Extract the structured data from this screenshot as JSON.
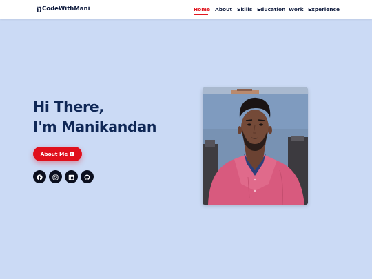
{
  "brand": {
    "name": "CodeWithMani"
  },
  "nav": {
    "items": [
      {
        "label": "Home",
        "active": true
      },
      {
        "label": "About"
      },
      {
        "label": "Skills"
      },
      {
        "label": "Education"
      },
      {
        "label": "Work"
      },
      {
        "label": "Experience"
      }
    ]
  },
  "hero": {
    "greeting": "Hi There,",
    "name_line": "I'm Manikandan",
    "cta_label": "About Me"
  },
  "socials": [
    {
      "icon": "facebook-icon"
    },
    {
      "icon": "instagram-icon"
    },
    {
      "icon": "linkedin-icon"
    },
    {
      "icon": "github-icon"
    }
  ],
  "colors": {
    "background": "#cbdaf5",
    "nav_active": "#e0161f",
    "heading": "#0f2756",
    "cta": "#e0101c",
    "social_bg": "#0b0f1e"
  }
}
